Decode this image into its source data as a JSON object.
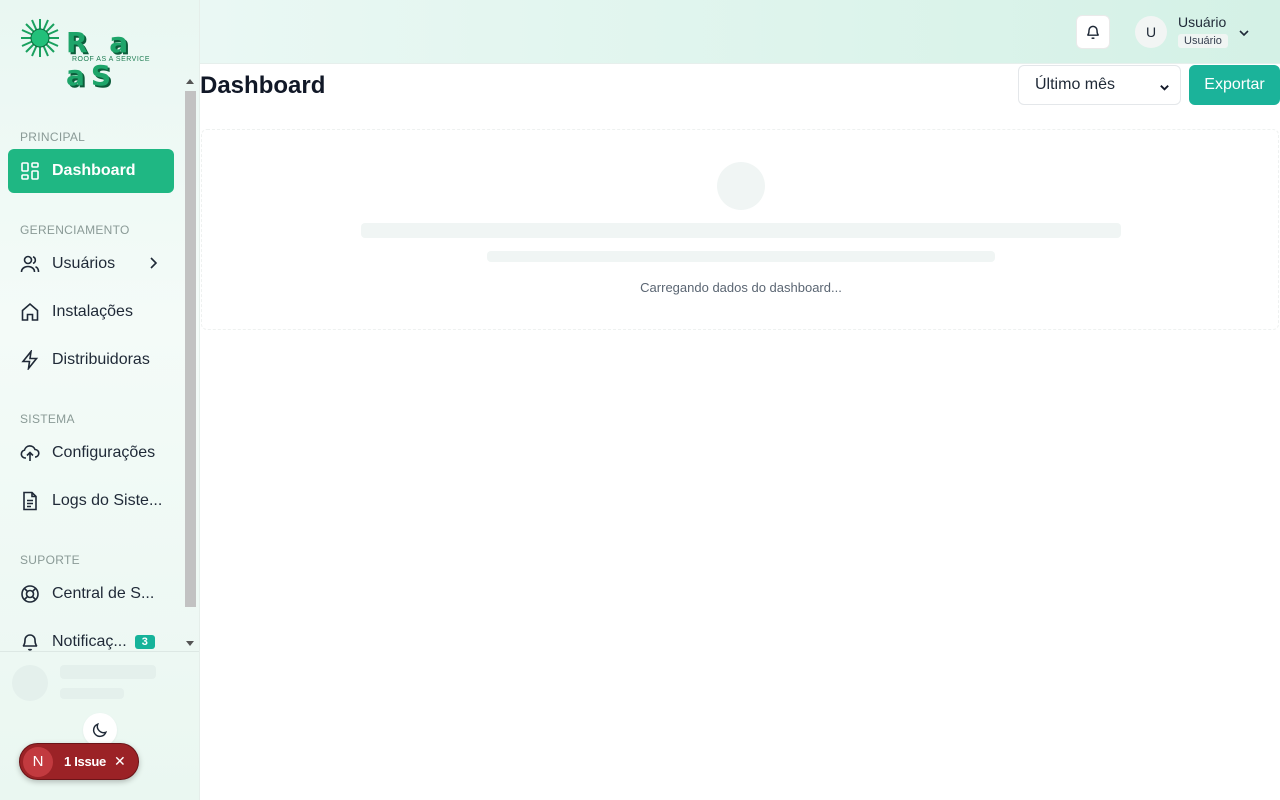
{
  "brand": {
    "logo_text": "R a aS",
    "logo_sub": "ROOF AS A SERVICE",
    "accent": "#1fb783"
  },
  "header": {
    "user_initial": "U",
    "user_name": "Usuário",
    "user_role": "Usuário"
  },
  "sidebar": {
    "sections": [
      {
        "label": "PRINCIPAL"
      },
      {
        "label": "GERENCIAMENTO"
      },
      {
        "label": "SISTEMA"
      },
      {
        "label": "SUPORTE"
      }
    ],
    "items": [
      {
        "label": "Dashboard",
        "icon": "dashboard-grid-icon",
        "active": true
      },
      {
        "label": "Usuários",
        "icon": "users-icon"
      },
      {
        "label": "Instalações",
        "icon": "home-icon"
      },
      {
        "label": "Distribuidoras",
        "icon": "lightning-icon"
      },
      {
        "label": "Configurações",
        "icon": "cloud-upload-icon"
      },
      {
        "label": "Logs do Siste...",
        "icon": "document-icon"
      },
      {
        "label": "Central de S...",
        "icon": "lifebuoy-icon"
      },
      {
        "label": "Notificaç...",
        "icon": "bell-icon",
        "badge": "3"
      }
    ]
  },
  "issue": {
    "initial": "N",
    "label": "1 Issue"
  },
  "main": {
    "title": "Dashboard",
    "period": "Último mês",
    "export_label": "Exportar",
    "loading_text": "Carregando dados do dashboard..."
  }
}
